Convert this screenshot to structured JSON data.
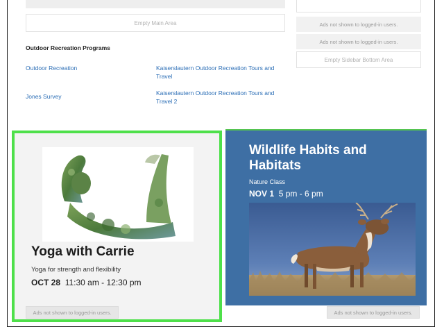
{
  "top": {
    "empty_main": "Empty Main Area",
    "ads": [
      "Ads not shown to logged-in users.",
      "Ads not shown to logged-in users."
    ],
    "empty_sidebar_bottom": "Empty Sidebar Bottom Area"
  },
  "programs": {
    "title": "Outdoor Recreation Programs",
    "rows": [
      {
        "name": "Outdoor Recreation",
        "category": "Kaiserslautern Outdoor Recreation Tours and Travel"
      },
      {
        "name": "Jones Survey",
        "category": "Kaiserslautern Outdoor Recreation Tours and Travel 2"
      }
    ]
  },
  "cards": {
    "yoga": {
      "title": "Yoga with Carrie",
      "subtitle": "Yoga for strength and flexibility",
      "date": "OCT 28",
      "time": "11:30 am - 12:30 pm",
      "ad": "Ads not shown to logged-in users."
    },
    "wildlife": {
      "title": "Wildlife Habits and Habitats",
      "subtitle": "Nature Class",
      "date": "NOV 1",
      "time": "5 pm - 6 pm",
      "ad": "Ads not shown to logged-in users."
    }
  },
  "colors": {
    "link": "#2a6db5",
    "highlight_border": "#4ee04a",
    "wildlife_bg": "#3e6fa4"
  }
}
